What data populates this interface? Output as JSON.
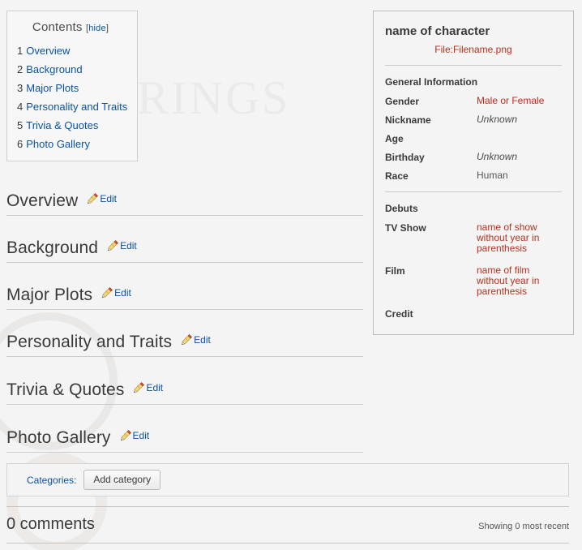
{
  "toc": {
    "title": "Contents",
    "hide_label": "hide",
    "bracket_open": "[",
    "bracket_close": "]",
    "items": [
      {
        "num": "1",
        "label": "Overview"
      },
      {
        "num": "2",
        "label": "Background"
      },
      {
        "num": "3",
        "label": "Major Plots"
      },
      {
        "num": "4",
        "label": "Personality and Traits"
      },
      {
        "num": "5",
        "label": "Trivia & Quotes"
      },
      {
        "num": "6",
        "label": "Photo Gallery"
      }
    ]
  },
  "sections": [
    {
      "title": "Overview",
      "edit_label": "Edit",
      "edit_icon": "pencil-icon"
    },
    {
      "title": "Background",
      "edit_label": "Edit",
      "edit_icon": "pencil-icon"
    },
    {
      "title": "Major Plots",
      "edit_label": "Edit",
      "edit_icon": "pencil-icon"
    },
    {
      "title": "Personality and Traits",
      "edit_label": "Edit",
      "edit_icon": "pencil-icon"
    },
    {
      "title": "Trivia & Quotes",
      "edit_label": "Edit",
      "edit_icon": "pencil-icon"
    },
    {
      "title": "Photo Gallery",
      "edit_label": "Edit",
      "edit_icon": "pencil-icon"
    }
  ],
  "infobox": {
    "title": "name of character",
    "image_link": "File:Filename.png",
    "groups": [
      {
        "heading": "General Information",
        "rows": [
          {
            "label": "Gender",
            "value": "Male or Female",
            "style": "red"
          },
          {
            "label": "Nickname",
            "value": "Unknown",
            "style": "italic"
          },
          {
            "label": "Age",
            "value": "",
            "style": "plain"
          },
          {
            "label": "Birthday",
            "value": "Unknown",
            "style": "italic"
          },
          {
            "label": "Race",
            "value": "Human",
            "style": "plain"
          }
        ]
      },
      {
        "heading": "Debuts",
        "rows": [
          {
            "label": "TV Show",
            "value": "name of show without year in parenthesis",
            "style": "red"
          },
          {
            "label": "Film",
            "value": "name of film without year in parenthesis",
            "style": "red"
          },
          {
            "label": "Credit",
            "value": "",
            "style": "plain"
          }
        ]
      }
    ]
  },
  "categories": {
    "label": "Categories:",
    "add_button": "Add category"
  },
  "comments": {
    "title": "0 comments",
    "showing": "Showing 0 most recent"
  },
  "colors": {
    "link_blue": "#0b52a1",
    "link_red": "#b9301c",
    "text_dark": "#3a3a3a",
    "page_bg": "#f4f4f4",
    "border_gray": "#cccccc"
  }
}
